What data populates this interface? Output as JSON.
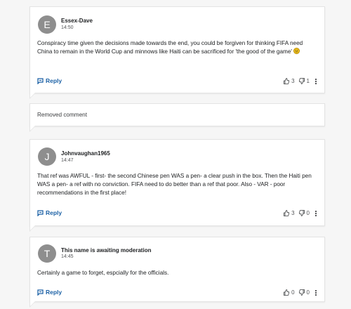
{
  "comments": [
    {
      "avatar_letter": "E",
      "author": "Essex-Dave",
      "time": "14:50",
      "text": "Conspiracy time given the decisions made towards the end, you could be forgiven for thinking FIFA need China to remain in the World Cup and minnows like Haiti can be sacrificed for 'the good of the game'",
      "emoji": "smile-emoji",
      "reply_label": "Reply",
      "upvotes": "3",
      "downvotes": "1"
    },
    {
      "removed_text": "Removed comment"
    },
    {
      "avatar_letter": "J",
      "author": "Johnvaughan1965",
      "time": "14:47",
      "text": "That ref was AWFUL - first- the second Chinese pen WAS a pen- a clear push in the box. Then the Haiti pen WAS a pen- a ref with no conviction. FIFA need to do better than a ref that poor. Also - VAR - poor recommendations in the first place!",
      "reply_label": "Reply",
      "upvotes": "3",
      "downvotes": "0"
    },
    {
      "avatar_letter": "T",
      "author": "This name is awaiting moderation",
      "time": "14:45",
      "text": "Certainly a game to forget, espcially for the officials.",
      "reply_label": "Reply",
      "upvotes": "0",
      "downvotes": "0"
    }
  ],
  "icons": {
    "reply": "reply-flag-icon",
    "upvote": "thumbs-up-icon",
    "downvote": "thumbs-down-icon",
    "more": "more-vertical-icon"
  },
  "colors": {
    "accent": "#1d62a6",
    "avatar_bg": "#8e8e8e",
    "page_bg": "#f6f6f6"
  }
}
